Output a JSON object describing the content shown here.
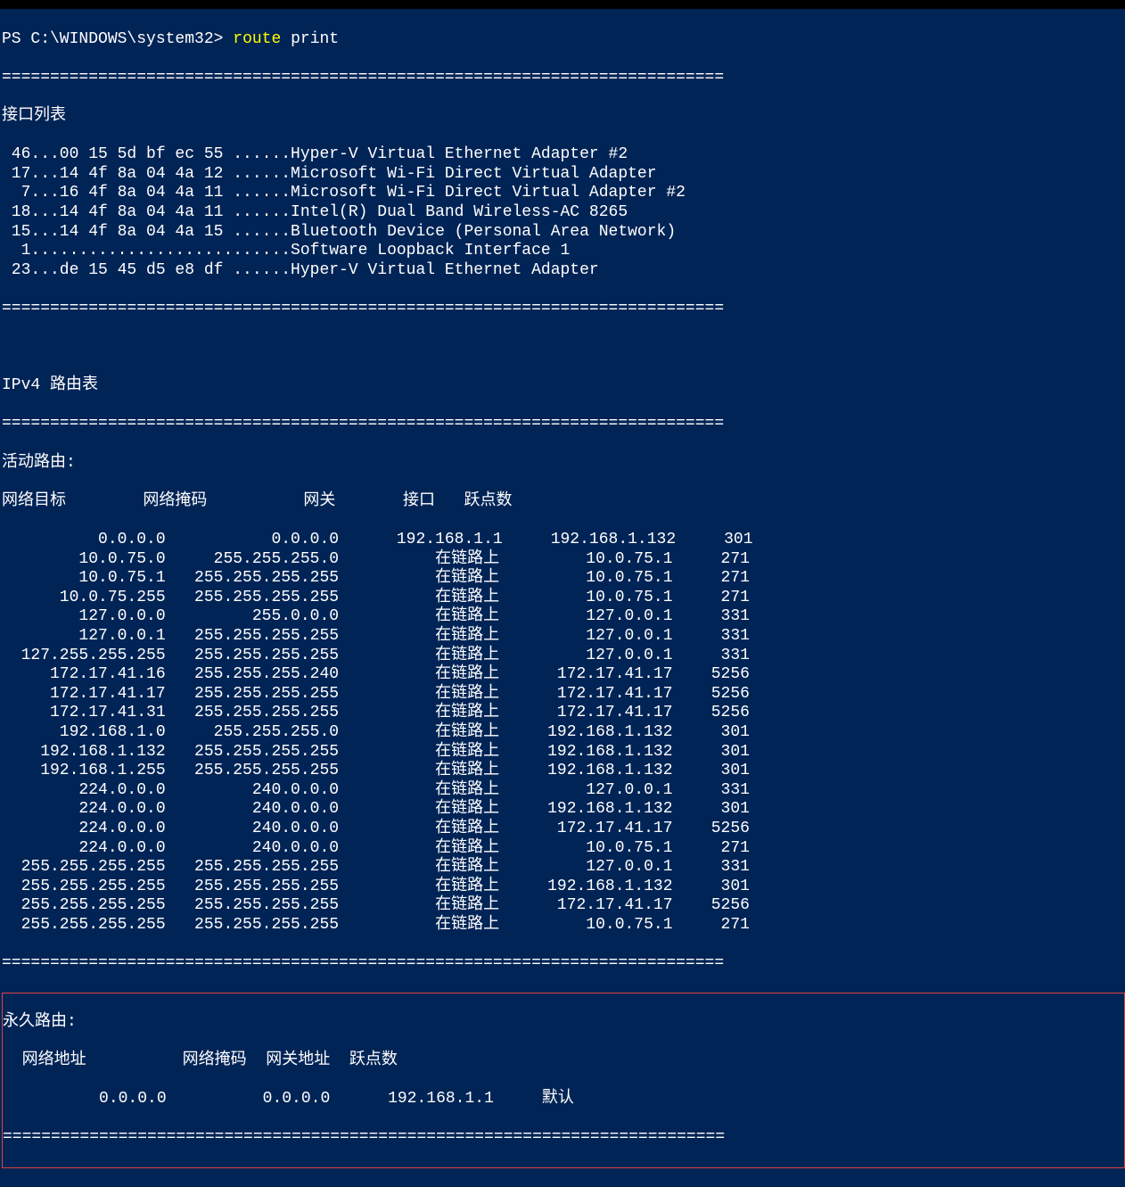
{
  "prompt": {
    "path": "PS C:\\WINDOWS\\system32>",
    "command": "route",
    "arg": "print"
  },
  "divider": "===========================================================================",
  "interface_header": "接口列表",
  "interfaces": [
    " 46...00 15 5d bf ec 55 ......Hyper-V Virtual Ethernet Adapter #2",
    " 17...14 4f 8a 04 4a 12 ......Microsoft Wi-Fi Direct Virtual Adapter",
    "  7...16 4f 8a 04 4a 11 ......Microsoft Wi-Fi Direct Virtual Adapter #2",
    " 18...14 4f 8a 04 4a 11 ......Intel(R) Dual Band Wireless-AC 8265",
    " 15...14 4f 8a 04 4a 15 ......Bluetooth Device (Personal Area Network)",
    "  1...........................Software Loopback Interface 1",
    " 23...de 15 45 d5 e8 df ......Hyper-V Virtual Ethernet Adapter"
  ],
  "ipv4_header": "IPv4 路由表",
  "active_routes_label": "活动路由:",
  "route_columns": "网络目标        网络掩码          网关       接口   跃点数",
  "routes": [
    {
      "dest": "0.0.0.0",
      "mask": "0.0.0.0",
      "gateway": "192.168.1.1",
      "iface": "192.168.1.132",
      "metric": "301"
    },
    {
      "dest": "10.0.75.0",
      "mask": "255.255.255.0",
      "gateway": "在链路上",
      "iface": "10.0.75.1",
      "metric": "271"
    },
    {
      "dest": "10.0.75.1",
      "mask": "255.255.255.255",
      "gateway": "在链路上",
      "iface": "10.0.75.1",
      "metric": "271"
    },
    {
      "dest": "10.0.75.255",
      "mask": "255.255.255.255",
      "gateway": "在链路上",
      "iface": "10.0.75.1",
      "metric": "271"
    },
    {
      "dest": "127.0.0.0",
      "mask": "255.0.0.0",
      "gateway": "在链路上",
      "iface": "127.0.0.1",
      "metric": "331"
    },
    {
      "dest": "127.0.0.1",
      "mask": "255.255.255.255",
      "gateway": "在链路上",
      "iface": "127.0.0.1",
      "metric": "331"
    },
    {
      "dest": "127.255.255.255",
      "mask": "255.255.255.255",
      "gateway": "在链路上",
      "iface": "127.0.0.1",
      "metric": "331"
    },
    {
      "dest": "172.17.41.16",
      "mask": "255.255.255.240",
      "gateway": "在链路上",
      "iface": "172.17.41.17",
      "metric": "5256"
    },
    {
      "dest": "172.17.41.17",
      "mask": "255.255.255.255",
      "gateway": "在链路上",
      "iface": "172.17.41.17",
      "metric": "5256"
    },
    {
      "dest": "172.17.41.31",
      "mask": "255.255.255.255",
      "gateway": "在链路上",
      "iface": "172.17.41.17",
      "metric": "5256"
    },
    {
      "dest": "192.168.1.0",
      "mask": "255.255.255.0",
      "gateway": "在链路上",
      "iface": "192.168.1.132",
      "metric": "301"
    },
    {
      "dest": "192.168.1.132",
      "mask": "255.255.255.255",
      "gateway": "在链路上",
      "iface": "192.168.1.132",
      "metric": "301"
    },
    {
      "dest": "192.168.1.255",
      "mask": "255.255.255.255",
      "gateway": "在链路上",
      "iface": "192.168.1.132",
      "metric": "301"
    },
    {
      "dest": "224.0.0.0",
      "mask": "240.0.0.0",
      "gateway": "在链路上",
      "iface": "127.0.0.1",
      "metric": "331"
    },
    {
      "dest": "224.0.0.0",
      "mask": "240.0.0.0",
      "gateway": "在链路上",
      "iface": "192.168.1.132",
      "metric": "301"
    },
    {
      "dest": "224.0.0.0",
      "mask": "240.0.0.0",
      "gateway": "在链路上",
      "iface": "172.17.41.17",
      "metric": "5256"
    },
    {
      "dest": "224.0.0.0",
      "mask": "240.0.0.0",
      "gateway": "在链路上",
      "iface": "10.0.75.1",
      "metric": "271"
    },
    {
      "dest": "255.255.255.255",
      "mask": "255.255.255.255",
      "gateway": "在链路上",
      "iface": "127.0.0.1",
      "metric": "331"
    },
    {
      "dest": "255.255.255.255",
      "mask": "255.255.255.255",
      "gateway": "在链路上",
      "iface": "192.168.1.132",
      "metric": "301"
    },
    {
      "dest": "255.255.255.255",
      "mask": "255.255.255.255",
      "gateway": "在链路上",
      "iface": "172.17.41.17",
      "metric": "5256"
    },
    {
      "dest": "255.255.255.255",
      "mask": "255.255.255.255",
      "gateway": "在链路上",
      "iface": "10.0.75.1",
      "metric": "271"
    }
  ],
  "persistent_routes_label": "永久路由:",
  "persistent_columns": "  网络地址          网络掩码  网关地址  跃点数",
  "persistent_routes": [
    {
      "addr": "0.0.0.0",
      "mask": "0.0.0.0",
      "gateway": "192.168.1.1",
      "metric": "默认"
    }
  ]
}
